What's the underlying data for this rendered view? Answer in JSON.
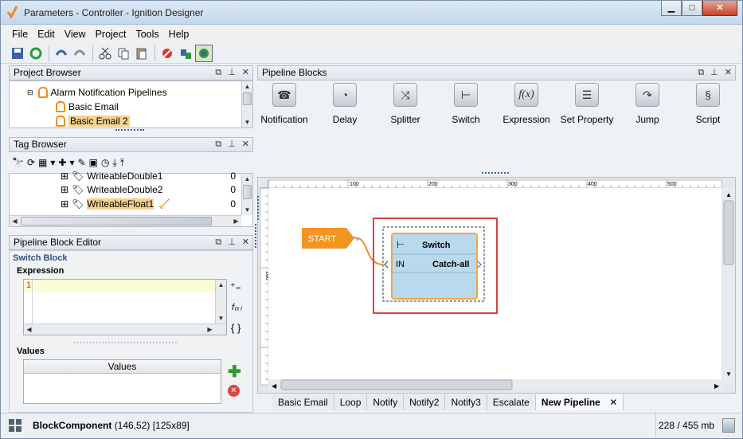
{
  "window": {
    "title": "Parameters - Controller - Ignition Designer"
  },
  "menu": [
    "File",
    "Edit",
    "View",
    "Project",
    "Tools",
    "Help"
  ],
  "project_browser": {
    "title": "Project Browser",
    "items": [
      "Alarm Notification Pipelines",
      "Basic Email",
      "Basic Email 2"
    ]
  },
  "tag_browser": {
    "title": "Tag Browser",
    "rows": [
      {
        "name": "WriteableDouble1",
        "value": "0"
      },
      {
        "name": "WriteableDouble2",
        "value": "0"
      },
      {
        "name": "WriteableFloat1",
        "value": "0"
      }
    ]
  },
  "block_editor": {
    "title": "Pipeline Block Editor",
    "section": "Switch Block",
    "expression_label": "Expression",
    "line_number": "1",
    "values_label": "Values",
    "values_column": "Values"
  },
  "pipeline_blocks": {
    "title": "Pipeline Blocks",
    "items": [
      "Notification",
      "Delay",
      "Splitter",
      "Switch",
      "Expression",
      "Set Property",
      "Jump",
      "Script"
    ]
  },
  "canvas": {
    "ruler_labels": [
      "100",
      "200",
      "300",
      "400",
      "500"
    ],
    "vertical_ruler_label": "100",
    "start_label": "START",
    "switch_block": {
      "title": "Switch",
      "input": "IN",
      "output": "Catch-all"
    }
  },
  "tabs": [
    {
      "label": "Basic Email",
      "active": false
    },
    {
      "label": "Loop",
      "active": false
    },
    {
      "label": "Notify",
      "active": false
    },
    {
      "label": "Notify2",
      "active": false
    },
    {
      "label": "Notify3",
      "active": false
    },
    {
      "label": "Escalate",
      "active": false
    },
    {
      "label": "New Pipeline",
      "active": true
    }
  ],
  "tab_close_glyph": "✕",
  "status": {
    "component": "BlockComponent",
    "coords": "(146,52) [125x89]",
    "memory": "228 / 455 mb"
  },
  "colors": {
    "start": "#f29523",
    "switch_fill": "#b9d9ee",
    "switch_border": "#f0a640",
    "selection": "#d64545"
  }
}
